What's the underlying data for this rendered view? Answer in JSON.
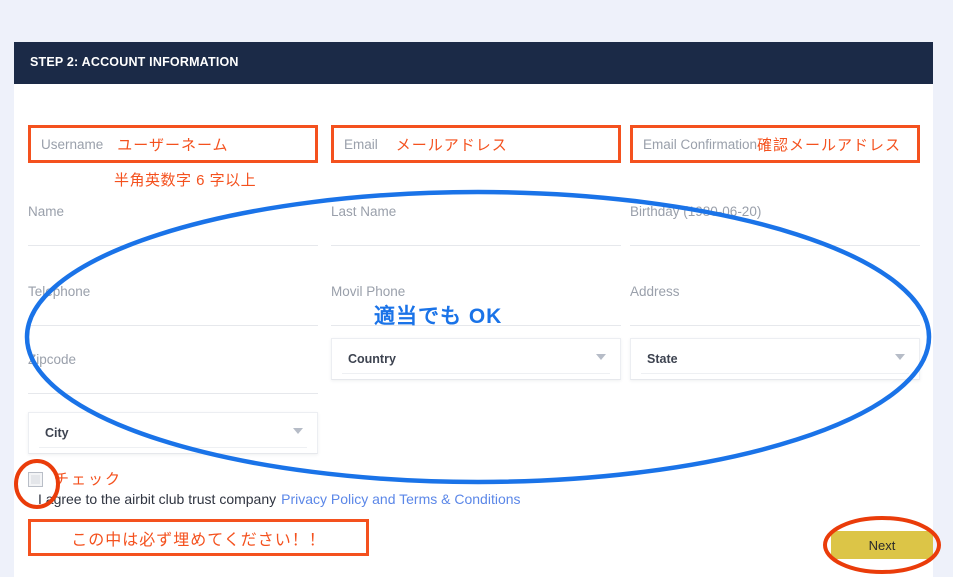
{
  "page": {
    "background_color": "#eef1fa",
    "card_color": "#ffffff"
  },
  "header": {
    "title": "STEP 2: ACCOUNT INFORMATION",
    "background_color": "#1b2a47",
    "text_color": "#ffffff"
  },
  "annotations": {
    "color_orange": "#f4511e",
    "color_blue": "#1a73e8",
    "username_jp": "ユーザーネーム",
    "username_rule": "半角英数字 6 字以上",
    "email_jp": "メールアドレス",
    "email_confirmation_jp": "確認メールアドレス",
    "checkbox_jp": "チェック",
    "blue_note": "適当でも OK",
    "warning": "この中は必ず埋めてください！！"
  },
  "form": {
    "annotated_fields": [
      {
        "label": "Username",
        "jp": "ユーザーネーム"
      },
      {
        "label": "Email",
        "jp": "メールアドレス"
      },
      {
        "label": "Email Confirmation",
        "jp": "確認メールアドレス"
      }
    ],
    "text_fields": [
      {
        "label": "Name",
        "value": ""
      },
      {
        "label": "Last Name",
        "value": ""
      },
      {
        "label": "Birthday (1980-06-20)",
        "value": ""
      },
      {
        "label": "Telephone",
        "value": ""
      },
      {
        "label": "Movil Phone",
        "value": ""
      },
      {
        "label": "Address",
        "value": ""
      },
      {
        "label": "Zipcode",
        "value": ""
      }
    ],
    "dropdowns": [
      {
        "label": "Country",
        "selected": "Country"
      },
      {
        "label": "State",
        "selected": "State"
      },
      {
        "label": "City",
        "selected": "City"
      }
    ],
    "consent": {
      "checked": false,
      "text": "I agree to the airbit club trust company",
      "link_text": "Privacy Policy and Terms & Conditions",
      "link_color": "#5b87e8"
    }
  },
  "footer": {
    "next_label": "Next",
    "next_color": "#dcc547"
  }
}
